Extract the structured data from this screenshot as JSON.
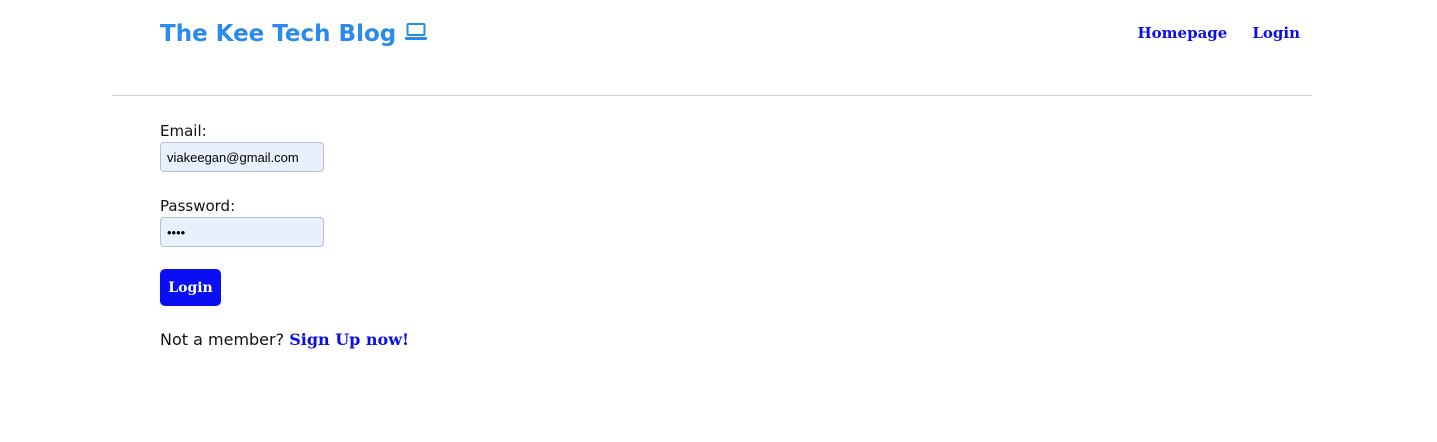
{
  "header": {
    "brand_title": "The Kee Tech Blog",
    "brand_icon": "laptop-icon",
    "nav": {
      "homepage": "Homepage",
      "login": "Login"
    }
  },
  "login_form": {
    "email_label": "Email:",
    "email_value": "viakeegan@gmail.com",
    "password_label": "Password:",
    "password_value": "••••",
    "submit_label": "Login",
    "signup_prompt": "Not a member?",
    "signup_link": "Sign Up now!"
  },
  "colors": {
    "brand": "#2a8aed",
    "link": "#0a0ee8",
    "button": "#0a0ef5",
    "input_bg": "#e8f0fe"
  }
}
